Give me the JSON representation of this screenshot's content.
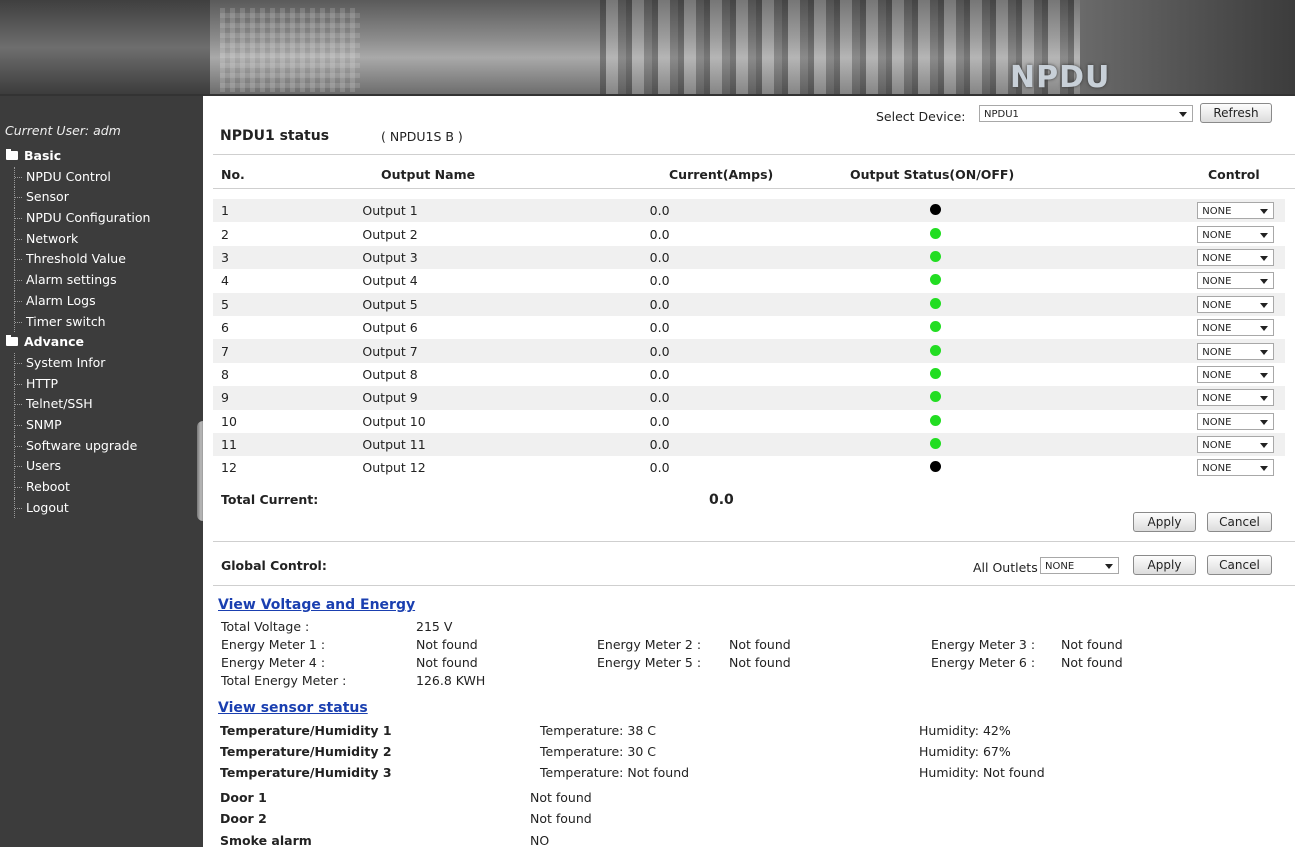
{
  "header": {
    "logo_text": "NPDU"
  },
  "sidebar": {
    "current_user": "Current User: adm",
    "items": [
      {
        "type": "group",
        "label": "Basic"
      },
      {
        "type": "item",
        "label": "NPDU Control"
      },
      {
        "type": "item",
        "label": "Sensor"
      },
      {
        "type": "item",
        "label": "NPDU Configuration"
      },
      {
        "type": "item",
        "label": "Network"
      },
      {
        "type": "item",
        "label": "Threshold Value"
      },
      {
        "type": "item",
        "label": "Alarm settings"
      },
      {
        "type": "item",
        "label": "Alarm Logs"
      },
      {
        "type": "item",
        "label": "Timer switch"
      },
      {
        "type": "group",
        "label": "Advance"
      },
      {
        "type": "item",
        "label": "System Infor"
      },
      {
        "type": "item",
        "label": "HTTP"
      },
      {
        "type": "item",
        "label": "Telnet/SSH"
      },
      {
        "type": "item",
        "label": "SNMP"
      },
      {
        "type": "item",
        "label": "Software upgrade"
      },
      {
        "type": "item",
        "label": "Users"
      },
      {
        "type": "item",
        "label": "Reboot"
      },
      {
        "type": "item",
        "label": "Logout"
      }
    ]
  },
  "toolbar": {
    "select_device_label": "Select Device:",
    "select_device_value": "NPDU1",
    "refresh_label": "Refresh"
  },
  "status": {
    "title": "NPDU1 status",
    "subtitle": "( NPDU1S B )"
  },
  "table": {
    "headers": {
      "no": "No.",
      "name": "Output Name",
      "current": "Current(Amps)",
      "status": "Output Status(ON/OFF)",
      "control": "Control"
    },
    "rows": [
      {
        "no": "1",
        "name": "Output 1",
        "current": "0.0",
        "state": "off",
        "control": "NONE"
      },
      {
        "no": "2",
        "name": "Output 2",
        "current": "0.0",
        "state": "on",
        "control": "NONE"
      },
      {
        "no": "3",
        "name": "Output 3",
        "current": "0.0",
        "state": "on",
        "control": "NONE"
      },
      {
        "no": "4",
        "name": "Output 4",
        "current": "0.0",
        "state": "on",
        "control": "NONE"
      },
      {
        "no": "5",
        "name": "Output 5",
        "current": "0.0",
        "state": "on",
        "control": "NONE"
      },
      {
        "no": "6",
        "name": "Output 6",
        "current": "0.0",
        "state": "on",
        "control": "NONE"
      },
      {
        "no": "7",
        "name": "Output 7",
        "current": "0.0",
        "state": "on",
        "control": "NONE"
      },
      {
        "no": "8",
        "name": "Output 8",
        "current": "0.0",
        "state": "on",
        "control": "NONE"
      },
      {
        "no": "9",
        "name": "Output 9",
        "current": "0.0",
        "state": "on",
        "control": "NONE"
      },
      {
        "no": "10",
        "name": "Output 10",
        "current": "0.0",
        "state": "on",
        "control": "NONE"
      },
      {
        "no": "11",
        "name": "Output 11",
        "current": "0.0",
        "state": "on",
        "control": "NONE"
      },
      {
        "no": "12",
        "name": "Output 12",
        "current": "0.0",
        "state": "off",
        "control": "NONE"
      }
    ],
    "total_label": "Total Current:",
    "total_value": "0.0",
    "apply_label": "Apply",
    "cancel_label": "Cancel"
  },
  "colors": {
    "on": "#22dd22",
    "off": "#000000",
    "sidebar_bg": "#3c3c3c",
    "link": "#1a3fb0"
  },
  "global_control": {
    "label": "Global Control:",
    "all_outlets_label": "All Outlets",
    "all_outlets_value": "NONE",
    "apply_label": "Apply",
    "cancel_label": "Cancel"
  },
  "voltage": {
    "link": "View Voltage and Energy",
    "total_voltage_label": "Total Voltage :",
    "total_voltage_value": "215 V",
    "meters": [
      {
        "label": "Energy Meter 1 :",
        "value": "Not found"
      },
      {
        "label": "Energy Meter 2 :",
        "value": "Not found"
      },
      {
        "label": "Energy Meter 3 :",
        "value": "Not found"
      },
      {
        "label": "Energy Meter 4 :",
        "value": "Not found"
      },
      {
        "label": "Energy Meter 5 :",
        "value": "Not found"
      },
      {
        "label": "Energy Meter 6 :",
        "value": "Not found"
      }
    ],
    "total_energy_label": "Total Energy Meter :",
    "total_energy_value": "126.8 KWH"
  },
  "sensors": {
    "link": "View sensor status",
    "th": [
      {
        "name": "Temperature/Humidity 1",
        "temp": "Temperature: 38 C",
        "hum": "Humidity: 42%"
      },
      {
        "name": "Temperature/Humidity 2",
        "temp": "Temperature: 30 C",
        "hum": "Humidity: 67%"
      },
      {
        "name": "Temperature/Humidity 3",
        "temp": "Temperature: Not found",
        "hum": "Humidity: Not found"
      }
    ],
    "others": [
      {
        "name": "Door 1",
        "value": "Not found"
      },
      {
        "name": "Door 2",
        "value": "Not found"
      },
      {
        "name": "Smoke alarm",
        "value": "NO"
      }
    ]
  }
}
